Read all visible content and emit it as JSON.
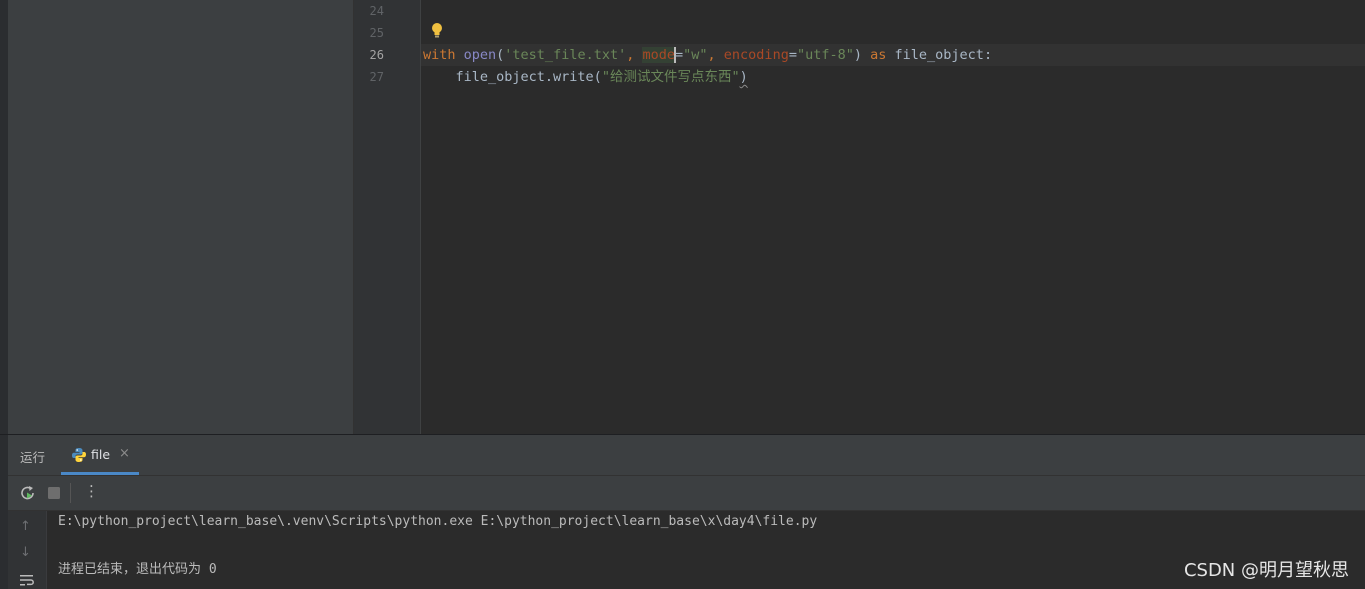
{
  "editor": {
    "line_numbers": [
      "24",
      "25",
      "26",
      "27"
    ],
    "line26": {
      "kw_with": "with ",
      "fn_open": "open",
      "p1": "(",
      "s_filename": "'test_file.txt'",
      "comma1": ", ",
      "param_mode": "mode",
      "eq1": "=",
      "s_mode": "\"w\"",
      "comma2": ", ",
      "param_encoding": "encoding",
      "eq2": "=",
      "s_encoding": "\"utf-8\"",
      "p2": ") ",
      "kw_as": "as",
      "rest": " file_object:"
    },
    "line27": {
      "call": "    file_object.write(",
      "s_content": "\"给测试文件写点东西\"",
      "close": ")"
    }
  },
  "run_panel": {
    "title": "运行",
    "tab_label": "file",
    "close_glyph": "×",
    "kebab_glyph": "⋮",
    "up_glyph": "↑",
    "down_glyph": "↓"
  },
  "console": {
    "command": "E:\\python_project\\learn_base\\.venv\\Scripts\\python.exe E:\\python_project\\learn_base\\x\\day4\\file.py",
    "exit_message": "进程已结束，退出代码为 0"
  },
  "watermark": "CSDN @明月望秋思",
  "colors": {
    "keyword": "#cc7832",
    "string": "#6a8759",
    "builtin": "#8888c6",
    "param": "#aa4926",
    "tab_underline": "#4a88c7"
  },
  "icons": [
    "lightbulb-icon",
    "python-icon",
    "rerun-icon",
    "stop-icon",
    "more-options-icon",
    "scroll-up-icon",
    "scroll-down-icon",
    "soft-wrap-icon"
  ]
}
